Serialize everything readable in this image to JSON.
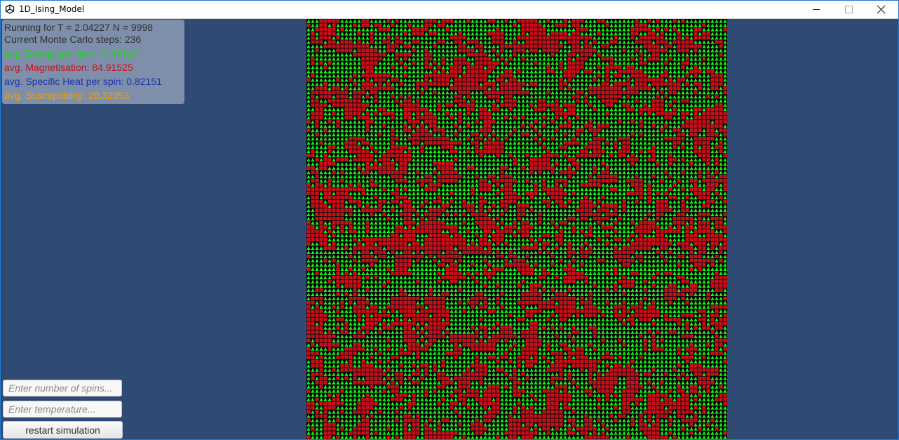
{
  "window": {
    "title": "1D_Ising_Model",
    "icon": "unity-logo-icon",
    "controls": [
      "minimize-icon",
      "maximize-icon",
      "close-icon"
    ]
  },
  "stats": {
    "run_info": "Running for T = 2.04227 N = 9998",
    "mc_steps": "Current Monte Carlo steps: 236",
    "energy": "avg. Energy per spin: -0.48717",
    "magnetisation": "avg. Magnetisation: 84.91525",
    "specific_heat": "avg. Specific Heat per spin: 0.82151",
    "susceptibility": "avg. Susceptibility: 20.32953"
  },
  "colors": {
    "background": "#2f4a73",
    "run_text": "#303030",
    "energy": "#1fd21f",
    "magnetisation": "#c0151e",
    "specific_heat": "#1d33a8",
    "susceptibility": "#f0a010",
    "spin_up": "#19f019",
    "spin_down": "#c4111b",
    "lattice_grid": "#000000"
  },
  "lattice": {
    "spin_up_icon": "green-up-arrow-icon",
    "spin_down_icon": "red-down-arrow-icon",
    "spins_per_row": 100,
    "rows": 100
  },
  "controls": {
    "spins_placeholder": "Enter number of spins...",
    "spins_value": "",
    "temperature_placeholder": "Enter temperature...",
    "temperature_value": "",
    "restart_label": "restart simulation"
  }
}
